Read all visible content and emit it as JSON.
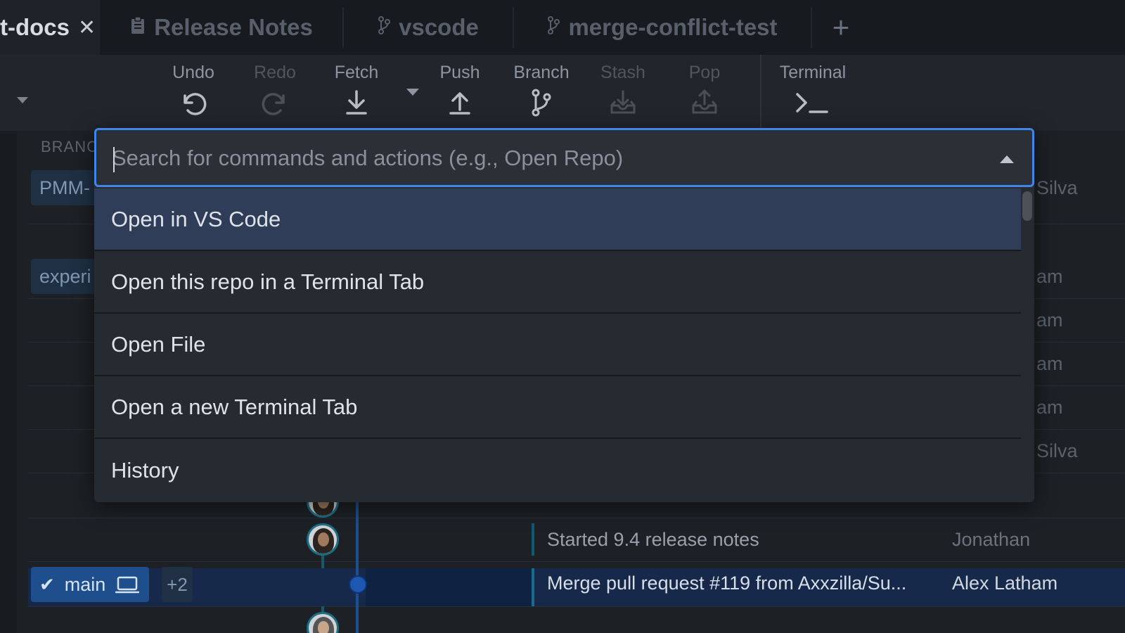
{
  "tabs": [
    {
      "label": "t-docs",
      "active": true,
      "icon": "none",
      "close": "✕"
    },
    {
      "label": "Release Notes",
      "icon": "clipboard-icon"
    },
    {
      "label": "vscode",
      "icon": "branch-icon"
    },
    {
      "label": "merge-conflict-test",
      "icon": "branch-icon"
    }
  ],
  "tab_add": "+",
  "toolbar": {
    "undo": "Undo",
    "redo": "Redo",
    "fetch": "Fetch",
    "push": "Push",
    "branch": "Branch",
    "stash": "Stash",
    "pop": "Pop",
    "terminal": "Terminal"
  },
  "left_panel": {
    "heading": "BRANCH",
    "branch_chip_1": "PMM-",
    "branch_chip_2": "experi"
  },
  "author_fragments": [
    "Silva",
    "am",
    "am",
    "am",
    "am",
    "Silva"
  ],
  "commits": [
    {
      "message": "Started 9.4 release notes",
      "author": "Jonathan"
    },
    {
      "message": "Merge pull request #119 from Axxzilla/Su...",
      "author": "Alex Latham"
    }
  ],
  "main_branch": {
    "label": "main",
    "extra": "+2"
  },
  "palette": {
    "placeholder": "Search for commands and actions (e.g., Open Repo)",
    "items": [
      "Open in VS Code",
      "Open this repo in a Terminal Tab",
      "Open File",
      "Open a new Terminal Tab",
      "History"
    ],
    "highlighted_index": 0
  },
  "colors": {
    "accent": "#3f86e8",
    "highlight": "#2f3d59",
    "background": "#1b1e23"
  }
}
